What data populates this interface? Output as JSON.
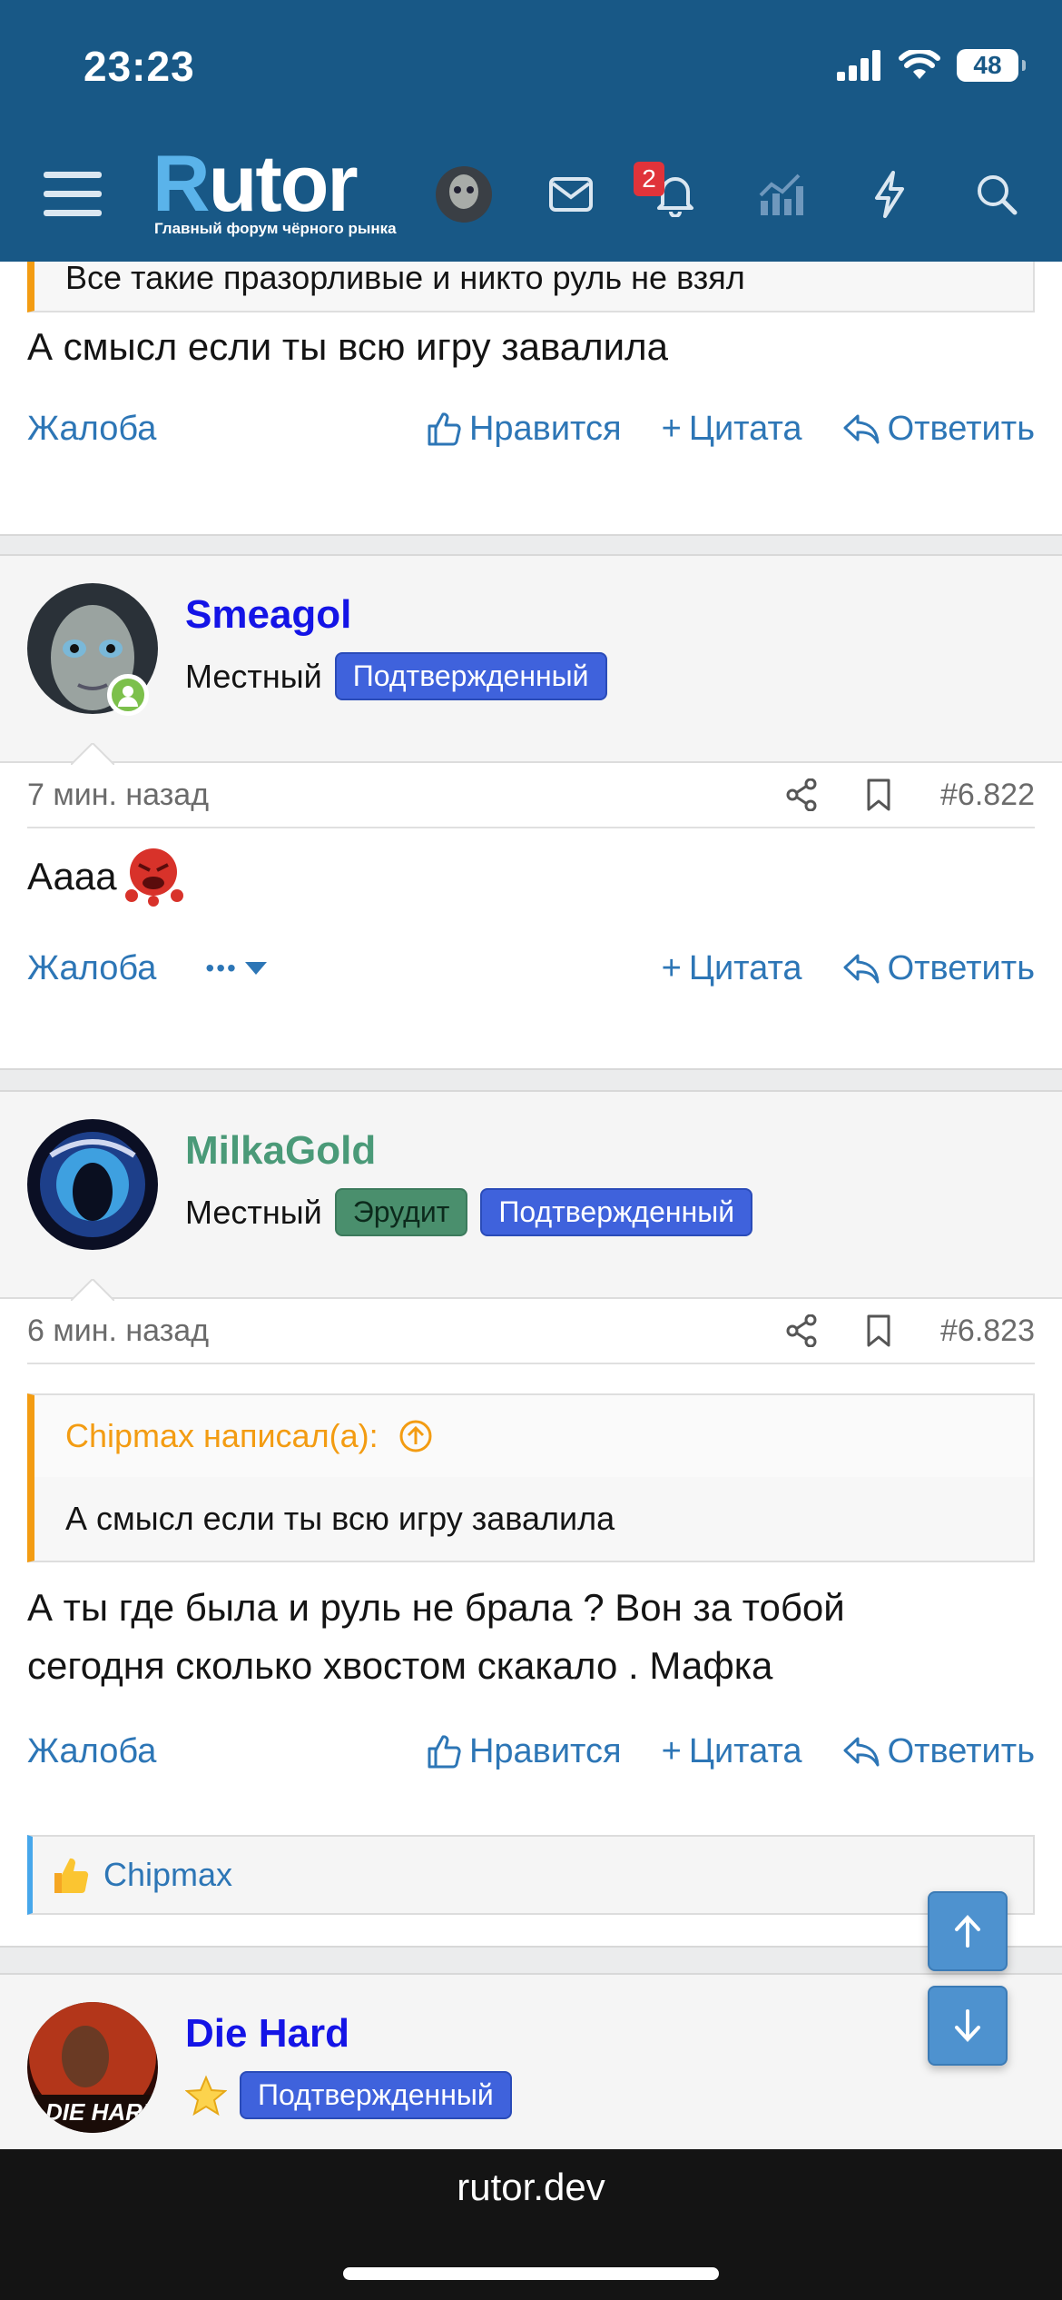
{
  "status_bar": {
    "time": "23:23",
    "battery": "48"
  },
  "header": {
    "logo": "Rutor",
    "logo_subtitle": "Главный форум чёрного рынка",
    "notifications_count": "2",
    "icons": [
      "menu-icon",
      "avatar",
      "mail-icon",
      "bell-icon",
      "chart-icon",
      "lightning-icon",
      "search-icon"
    ]
  },
  "post0": {
    "quote_text": "Все такие празорливые и никто руль не взял",
    "text": "А смысл если ты всю игру завалила",
    "actions": {
      "report": "Жалоба",
      "like": "Нравится",
      "quote": "Цитата",
      "reply": "Ответить"
    }
  },
  "post1": {
    "username": "Smeagol",
    "user_title": "Местный",
    "badges": [
      "Подтвержденный"
    ],
    "time": "7 мин. назад",
    "number": "#6.822",
    "text": "Аааа",
    "actions": {
      "report": "Жалоба",
      "more": "•••",
      "quote": "Цитата",
      "reply": "Ответить"
    }
  },
  "post2": {
    "username": "MilkaGold",
    "user_title": "Местный",
    "badges": [
      "Эрудит",
      "Подтвержденный"
    ],
    "time": "6 мин. назад",
    "number": "#6.823",
    "quote_author": "Chipmax написал(а):",
    "quote_text": "А смысл если ты всю игру завалила",
    "text_line1": "А ты где была и руль не брала ? Вон за тобой",
    "text_line2": "сегодня сколько хвостом скакало . Мафка",
    "actions": {
      "report": "Жалоба",
      "like": "Нравится",
      "quote": "Цитата",
      "reply": "Ответить"
    },
    "likes": "Chipmax"
  },
  "post3": {
    "username": "Die Hard",
    "badges": [
      "Подтвержденный"
    ]
  },
  "colors": {
    "header_bg": "#185886",
    "link": "#2d76b6",
    "username_blue": "#1414e6",
    "username_green": "#4a9a78",
    "badge_blue": "#3f62dc",
    "badge_green": "#4a8f6d",
    "quote_accent": "#f39c12"
  },
  "browser": {
    "url": "rutor.dev"
  }
}
